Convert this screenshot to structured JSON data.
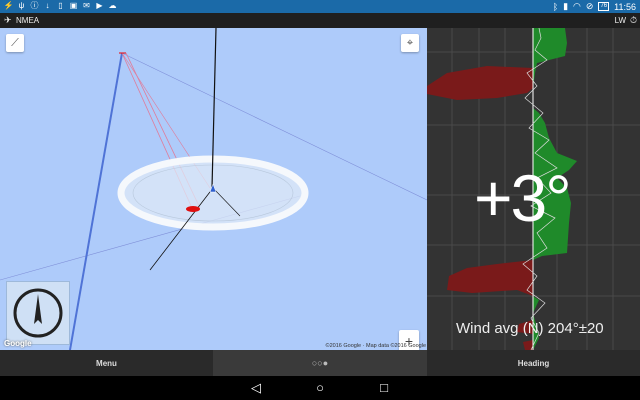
{
  "status_bar": {
    "left_icons": [
      "signal-icon",
      "usb-icon",
      "info-icon",
      "download-icon",
      "tablet-icon",
      "photo-icon",
      "mail-icon",
      "youtube-icon",
      "cloud-icon"
    ],
    "battery": "76",
    "time": "11:56"
  },
  "app_bar": {
    "title": "NMEA",
    "right_label": "LW"
  },
  "map": {
    "credit": "©2016 Google · Map data ©2016 Google",
    "logo": "Google",
    "zoom_in": "+",
    "zoom_out": "−"
  },
  "chart_panel": {
    "big_value": "+3°",
    "wind_label": "Wind avg (N) 204°±20",
    "colors": {
      "positive": "#228b22",
      "negative": "#8b1a1a",
      "background": "#333333",
      "grid": "#4a4a4a"
    }
  },
  "bottom_bar": {
    "menu_label": "Menu",
    "dots_label": "○○●",
    "heading_label": "Heading"
  }
}
